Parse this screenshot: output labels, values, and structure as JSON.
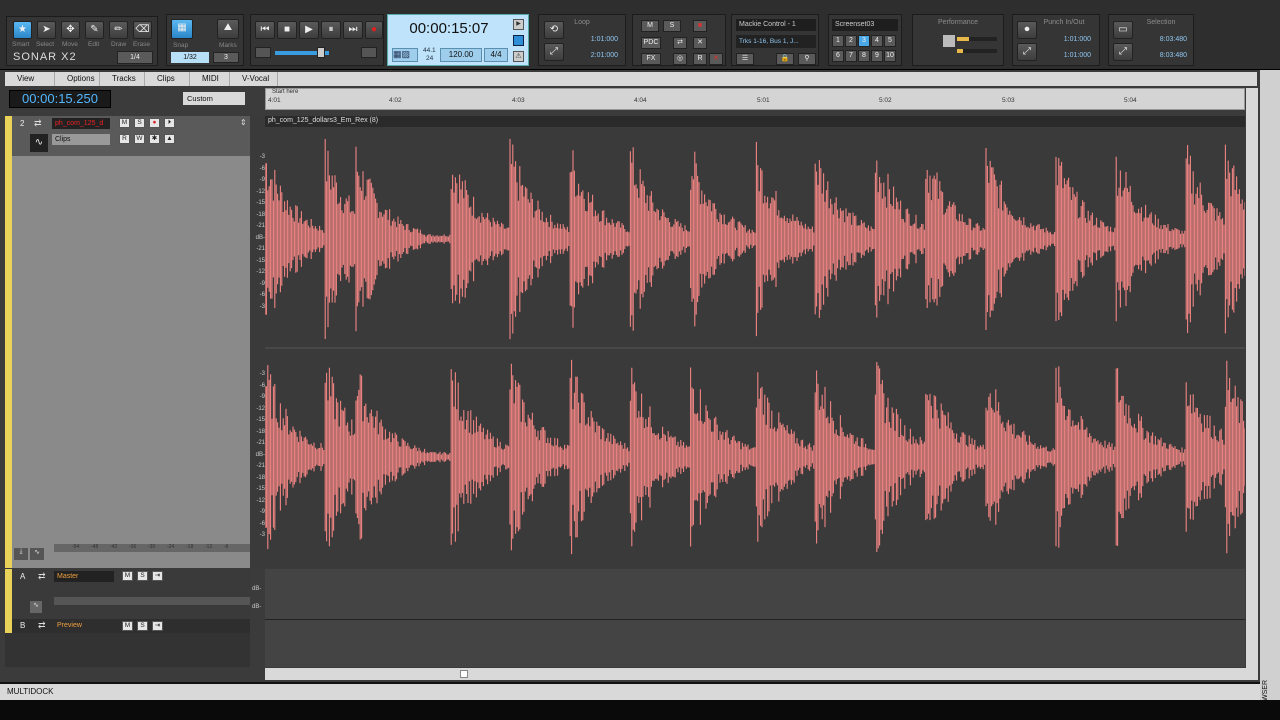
{
  "control_bar": {
    "tools": [
      {
        "label": "Smart",
        "icon": "star-icon"
      },
      {
        "label": "Select",
        "icon": "arrow-cursor-icon"
      },
      {
        "label": "Move",
        "icon": "move-cross-icon"
      },
      {
        "label": "Edit",
        "icon": "edit-icon"
      },
      {
        "label": "Draw",
        "icon": "pencil-icon"
      },
      {
        "label": "Erase",
        "icon": "eraser-icon"
      }
    ],
    "tools_value": "1/4",
    "logo": "SONAR X2",
    "snap_label": "Snap",
    "snap_value": "1/32",
    "marks_label": "Marks",
    "marks_value": "3",
    "transport_time": "00:00:15:07",
    "sample_rate": "44.1",
    "bit_depth": "24",
    "tempo": "120.00",
    "meter": "4/4",
    "loop_title": "Loop",
    "loop_start": "1:01:000",
    "loop_end": "2:01:000",
    "mix_buttons": [
      "M",
      "S",
      "PDC",
      "FX"
    ],
    "control_surface": "Mackie Control - 1",
    "control_tracks": "Trks 1-16, Bus 1, J...",
    "screenset_title": "Screenset03",
    "screensets": [
      "1",
      "2",
      "3",
      "4",
      "5",
      "6",
      "7",
      "8",
      "9",
      "10"
    ],
    "performance_title": "Performance",
    "punch_title": "Punch In/Out",
    "punch_start": "1:01:000",
    "punch_end": "1:01:000",
    "selection_title": "Selection",
    "selection_start": "8:03:480",
    "selection_end": "8:03:480"
  },
  "menubar": [
    "View",
    "Options",
    "Tracks",
    "Clips",
    "MIDI",
    "V-Vocal"
  ],
  "now_time": "00:00:15.250",
  "custom_select": "Custom",
  "ruler": {
    "start_label": "Start here",
    "ticks": [
      "4:01",
      "4:02",
      "4:03",
      "4:04",
      "5:01",
      "5:02",
      "5:03",
      "5:04"
    ]
  },
  "track": {
    "number": "2",
    "name": "ph_com_125_d",
    "buttons": [
      "M",
      "S",
      "R",
      "I"
    ],
    "view_select": "Clips",
    "view_buttons": [
      "R",
      "W"
    ]
  },
  "clip_name": "ph_com_125_dollars3_Em_Rex (8)",
  "db_scale_top": [
    "-3",
    "-6",
    "-9",
    "-12",
    "-15",
    "-18",
    "-21",
    "dB-",
    "-21",
    "-15",
    "-12",
    "-9",
    "-6",
    "-3"
  ],
  "db_scale_bottom": [
    "-3",
    "-6",
    "-9",
    "-12",
    "-15",
    "-18",
    "-21",
    "dB-",
    "-21",
    "-18",
    "-15",
    "-12",
    "-9",
    "-6",
    "-3"
  ],
  "meter_ticks": [
    "-54",
    "-48",
    "-42",
    "-36",
    "-30",
    "-24",
    "-18",
    "-12",
    "-6"
  ],
  "buses": [
    {
      "letter": "A",
      "name": "Master"
    },
    {
      "letter": "B",
      "name": "Preview"
    }
  ],
  "lower_db": [
    "dB-",
    "dB-"
  ],
  "multidock": "MULTIDOCK",
  "browser": "BROWSER",
  "waveform": {
    "color": "#f08482",
    "bg": "#3a3a3a"
  }
}
